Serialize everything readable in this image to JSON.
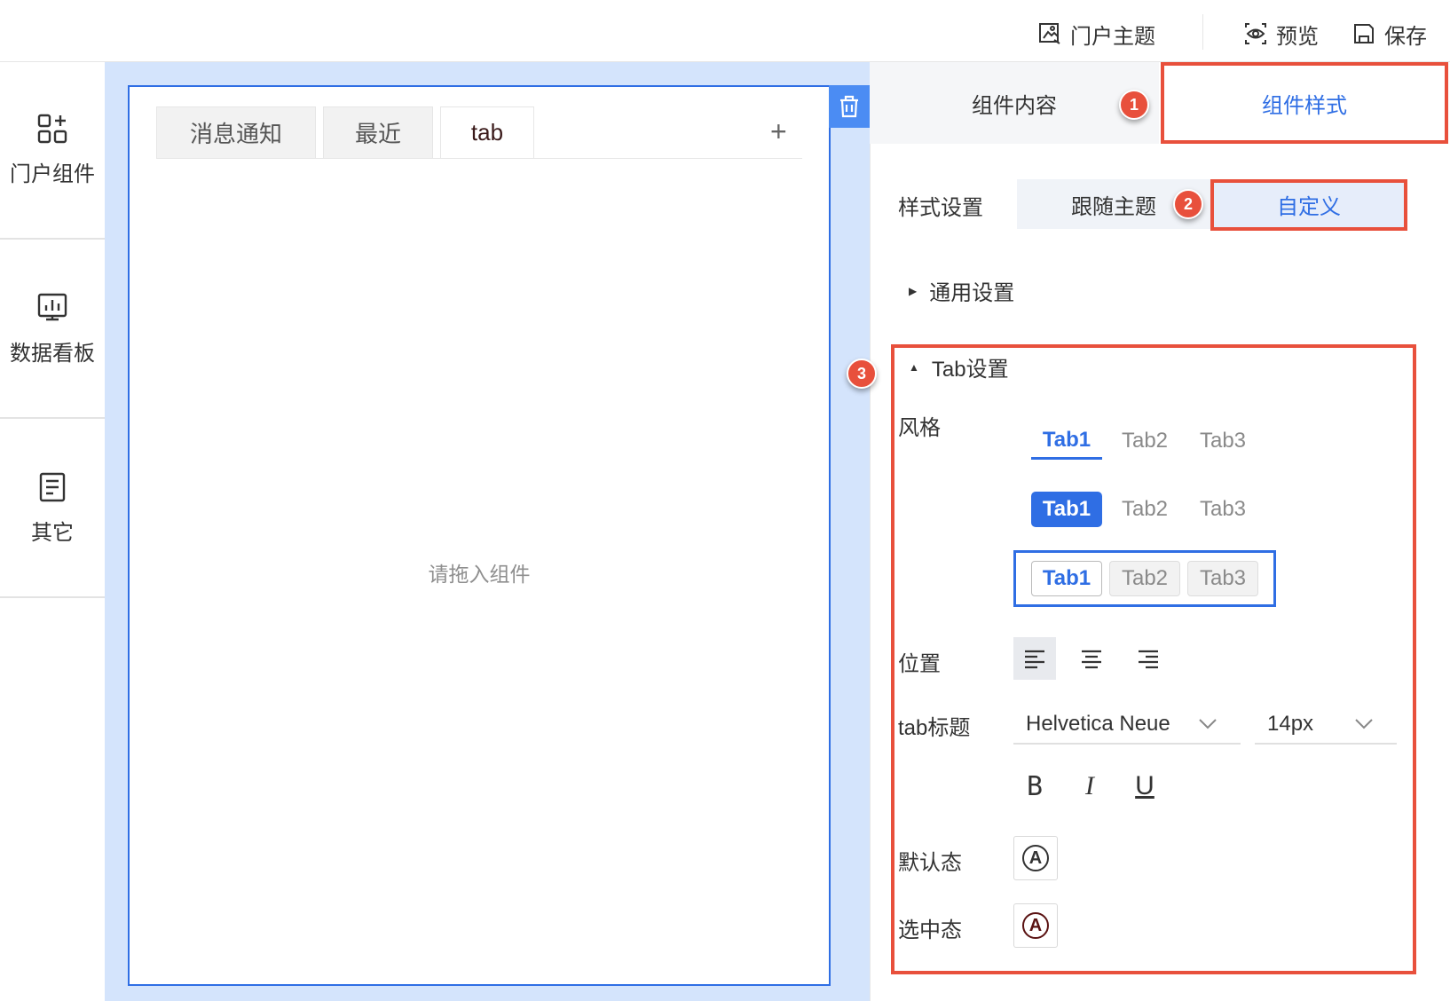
{
  "topbar": {
    "theme_label": "门户主题",
    "preview_label": "预览",
    "save_label": "保存"
  },
  "leftnav": {
    "items": [
      {
        "label": "门户组件",
        "icon": "grid-plus-icon"
      },
      {
        "label": "数据看板",
        "icon": "dashboard-chart-icon"
      },
      {
        "label": "其它",
        "icon": "document-icon"
      }
    ]
  },
  "widget": {
    "tabs": [
      "消息通知",
      "最近",
      "tab"
    ],
    "active_tab": "tab",
    "add_tab": "+",
    "placeholder": "请拖入组件"
  },
  "panel": {
    "tabs": {
      "content": "组件内容",
      "style": "组件样式"
    },
    "active_tab": "组件样式",
    "style_setting_label": "样式设置",
    "style_setting_options": [
      "跟随主题",
      "自定义"
    ],
    "style_setting_selected": "自定义",
    "general_section": "通用设置",
    "tab_section": "Tab设置",
    "style_label": "风格",
    "style_rows": [
      [
        "Tab1",
        "Tab2",
        "Tab3"
      ],
      [
        "Tab1",
        "Tab2",
        "Tab3"
      ],
      [
        "Tab1",
        "Tab2",
        "Tab3"
      ]
    ],
    "position_label": "位置",
    "position_selected": "left",
    "tab_title_label": "tab标题",
    "font_family": "Helvetica Neue",
    "font_size": "14px",
    "format_buttons": [
      "B",
      "I",
      "U"
    ],
    "default_state_label": "默认态",
    "selected_state_label": "选中态",
    "default_state_color": "#333333",
    "selected_state_color": "#5a1212"
  },
  "annotations": {
    "badges": [
      "1",
      "2",
      "3"
    ],
    "highlight_color": "#e8503c",
    "accent_color": "#2f6ee4"
  }
}
